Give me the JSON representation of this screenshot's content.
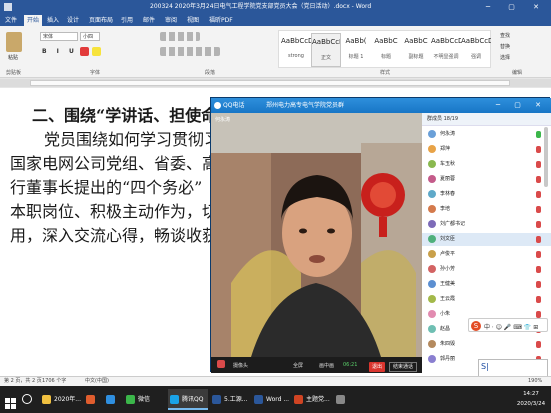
{
  "window": {
    "title": "200324 2020年3月24日电气工程学院党支部党员大会（党日活动）.docx - Word",
    "controls": "─ ▢ ✕"
  },
  "ribbon": {
    "tabs": [
      "文件",
      "开始",
      "插入",
      "设计",
      "页面布局",
      "引用",
      "邮件",
      "审阅",
      "视图",
      "福昕PDF"
    ],
    "active_tab": "开始",
    "font_name": "宋体",
    "font_size": "小四",
    "group_labels": {
      "clipboard": "剪贴板",
      "font": "字体",
      "paragraph": "段落",
      "styles": "样式",
      "editing": "编辑"
    },
    "clipboard": {
      "paste": "粘贴"
    },
    "editing": {
      "find": "查找",
      "replace": "替换",
      "select": "选择"
    },
    "styles": [
      {
        "preview": "AaBbCcDd",
        "name": "strong"
      },
      {
        "preview": "AaBbCcDd",
        "name": "正文",
        "selected": true
      },
      {
        "preview": "AaBb(",
        "name": "标题 1"
      },
      {
        "preview": "AaBbC",
        "name": "标题"
      },
      {
        "preview": "AaBbC",
        "name": "副标题"
      },
      {
        "preview": "AaBbCcDd",
        "name": "不明显强调"
      },
      {
        "preview": "AaBbCcDd",
        "name": "强调"
      }
    ]
  },
  "document": {
    "lines": [
      "二、围绕“学讲话、担使命",
      "党员围绕如何学习贯彻习近",
      "国家电网公司党组、省委、高校",
      "行董事长提出的“四个务必”",
      "本职岗位、积极主动作为，切实",
      "用，深入交流心得，畅谈收获体"
    ]
  },
  "qq": {
    "app": "QQ电话",
    "group": "郑州电力高专电气学院党员群",
    "caller": "何永涛",
    "members_header": "群成员 18/19",
    "members": [
      {
        "name": "何永涛",
        "color": "#6aa0d8",
        "mic_on": true
      },
      {
        "name": "郑萍",
        "color": "#e8a347"
      },
      {
        "name": "车玉秋",
        "color": "#8ab94f"
      },
      {
        "name": "夏丽蓉",
        "color": "#c45b8a"
      },
      {
        "name": "李林春",
        "color": "#5fa9c9"
      },
      {
        "name": "李培",
        "color": "#d47a4c"
      },
      {
        "name": "刘广都书记",
        "color": "#7d6bb8"
      },
      {
        "name": "刘文臣",
        "color": "#4fb07c",
        "selected": true
      },
      {
        "name": "卢俊平",
        "color": "#c9a04a"
      },
      {
        "name": "孙小芳",
        "color": "#d36363"
      },
      {
        "name": "王健美",
        "color": "#5c8fd1"
      },
      {
        "name": "王云霞",
        "color": "#a3b94a"
      },
      {
        "name": "小朱",
        "color": "#e28bb0"
      },
      {
        "name": "赵昌",
        "color": "#6fbfb3"
      },
      {
        "name": "朱四毁",
        "color": "#b48a5e"
      },
      {
        "name": "郭丹丽",
        "color": "#8a7fd0"
      }
    ],
    "controls": {
      "camera": "摄像头",
      "fullscreen": "全屏",
      "member_list": "画中画",
      "time": "06:21",
      "end": "退出",
      "end_meeting": "结束通话"
    }
  },
  "ime": {
    "logo": "S",
    "icons": "中 ⋅ ☺ 🎤 ⌨ 👕 ⊞",
    "input": "S|"
  },
  "status": {
    "page": "第 2 页，共 2 页",
    "words": "1706 个字",
    "lang": "中文(中国)",
    "zoom": "190%"
  },
  "taskbar": {
    "apps": [
      {
        "label": "2020年...",
        "color": "#f0c040"
      },
      {
        "label": "",
        "color": "#e05d2e"
      },
      {
        "label": "",
        "color": "#2f8fe0"
      },
      {
        "label": "微信",
        "color": "#3bb64a"
      },
      {
        "label": "腾讯QQ",
        "color": "#1aa3e8",
        "active": true
      },
      {
        "label": "5.工源...",
        "color": "#2b579a"
      },
      {
        "label": "Word ...",
        "color": "#2b579a"
      },
      {
        "label": "主题党...",
        "color": "#d04423"
      },
      {
        "label": "",
        "color": "#888"
      }
    ],
    "time": "14:27",
    "date": "2020/3/24"
  }
}
